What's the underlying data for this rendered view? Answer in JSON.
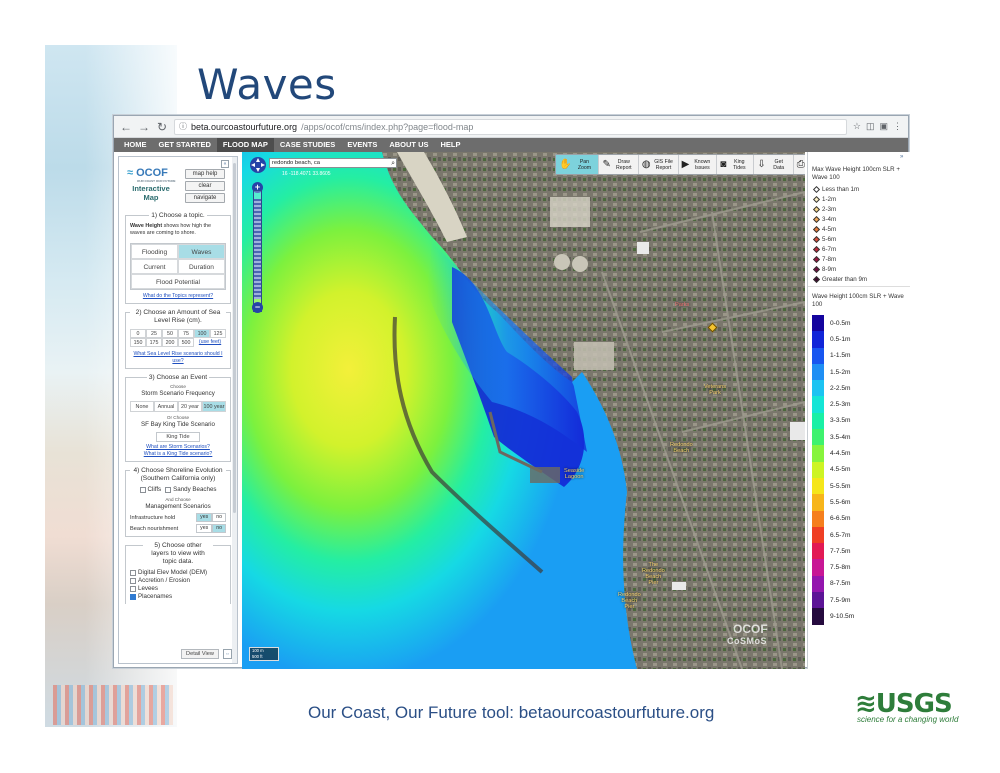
{
  "slide": {
    "title": "Waves",
    "footer": "Our Coast, Our Future tool: betaourcoastourfuture.org",
    "logo_text": "USGS",
    "logo_tagline": "science for a changing world"
  },
  "browser": {
    "url_host": "beta.ourcoastourfuture.org",
    "url_path": "/apps/ocof/cms/index.php?page=flood-map"
  },
  "site_nav": [
    {
      "label": "HOME",
      "active": false
    },
    {
      "label": "GET STARTED",
      "active": false
    },
    {
      "label": "FLOOD MAP",
      "active": true
    },
    {
      "label": "CASE STUDIES",
      "active": false
    },
    {
      "label": "EVENTS",
      "active": false
    },
    {
      "label": "ABOUT US",
      "active": false
    },
    {
      "label": "HELP",
      "active": false
    }
  ],
  "sidebar": {
    "logo": "OCOF",
    "logo_sub": "OUR COAST OUR FUTURE",
    "title": "Interactive Map",
    "buttons": {
      "map_help": "map help",
      "clear": "clear",
      "navigate": "navigate"
    },
    "s1": {
      "title": "1) Choose a topic.",
      "desc_bold": "Wave Height",
      "desc": " shows how high the waves are coming to shore.",
      "topics": [
        "Flooding",
        "Waves",
        "Current",
        "Duration"
      ],
      "topic_wide": "Flood Potential",
      "active_topic": "Waves",
      "link": "What do the Topics represent?"
    },
    "s2": {
      "title": "2) Choose an Amount of Sea Level Rise (cm).",
      "values": [
        "0",
        "25",
        "50",
        "75",
        "100",
        "125",
        "150",
        "175",
        "200",
        "500"
      ],
      "active": "100",
      "feet_link": "(use feet)",
      "link": "What Sea Level Rise scenario should I use?"
    },
    "s3": {
      "title": "3) Choose an Event",
      "choose": "Choose",
      "freq_label": "Storm Scenario Frequency",
      "events": [
        "None",
        "Annual",
        "20 year",
        "100 year"
      ],
      "active": "100 year",
      "or_choose": "Or Choose",
      "king_label": "SF Bay King Tide Scenario",
      "king_btn": "King Tide",
      "link1": "What are Storm Scenarios?",
      "link2": "What is a King Tide scenario?"
    },
    "s4": {
      "title": "4) Choose Shoreline Evolution (Southern California only)",
      "cliffs": "Cliffs",
      "sandy": "Sandy Beaches",
      "and_choose": "And Choose",
      "mgmt": "Management Scenarios",
      "infra": "Infrastructure hold",
      "beach": "Beach nourishment",
      "yes": "yes",
      "no": "no"
    },
    "s5": {
      "title": "5) Choose other layers to view with topic data.",
      "layers": [
        {
          "label": "Digital Elev Model (DEM)",
          "checked": false
        },
        {
          "label": "Accretion / Erosion",
          "checked": false
        },
        {
          "label": "Levees",
          "checked": false
        },
        {
          "label": "Placenames",
          "checked": true
        }
      ]
    },
    "detail_view": "Detail View"
  },
  "map": {
    "search_value": "redondo beach, ca",
    "coords": "16 -118.4071 33.8605",
    "scale_m": "100 m",
    "scale_ft": "500 ft",
    "watermark": "OCOF",
    "watermark2": "CoSMoS",
    "toolbar": [
      {
        "icon": "hand-icon",
        "glyph": "✋",
        "label": "Pan\nZoom",
        "active": true
      },
      {
        "icon": "pencil-icon",
        "glyph": "✎",
        "label": "Draw\nReport",
        "active": false
      },
      {
        "icon": "globe-icon",
        "glyph": "◍",
        "label": "GIS File\nReport",
        "active": false
      },
      {
        "icon": "play-icon",
        "glyph": "▶",
        "label": "Known\nIssues",
        "active": false
      },
      {
        "icon": "camera-icon",
        "glyph": "◙",
        "label": "King\nTides",
        "active": false
      },
      {
        "icon": "download-icon",
        "glyph": "⇩",
        "label": "Get\nData",
        "active": false
      },
      {
        "icon": "printer-icon",
        "glyph": "⎙",
        "label": "Print\nMap",
        "active": false
      }
    ],
    "places": [
      {
        "label": "Redondo\nBeach",
        "style": "big"
      },
      {
        "label": "Seaside\nLagoon",
        "style": "normal"
      },
      {
        "label": "Redondo\nBeach\nPier",
        "style": "normal"
      },
      {
        "label": "The\nRedondo\nBeach\nPier",
        "style": "normal"
      },
      {
        "label": "Veterans\nPark",
        "style": "normal"
      },
      {
        "label": "Parks",
        "style": "red"
      }
    ]
  },
  "legend": {
    "points_title": "Max Wave Height 100cm SLR + Wave 100",
    "points": [
      {
        "label": "Less than 1m",
        "color": "#ffffff"
      },
      {
        "label": "1-2m",
        "color": "#fdf1c4"
      },
      {
        "label": "2-3m",
        "color": "#f9d98a"
      },
      {
        "label": "3-4m",
        "color": "#f3a857"
      },
      {
        "label": "4-5m",
        "color": "#ea7d3b"
      },
      {
        "label": "5-6m",
        "color": "#d94f3b"
      },
      {
        "label": "6-7m",
        "color": "#c02a3b"
      },
      {
        "label": "7-8m",
        "color": "#99163f"
      },
      {
        "label": "8-9m",
        "color": "#6e0e3e"
      },
      {
        "label": "Greater than 9m",
        "color": "#3d0a2c"
      }
    ],
    "ramp_title": "Wave Height 100cm SLR + Wave 100",
    "ramp": [
      {
        "label": "0-0.5m",
        "color": "#14049e"
      },
      {
        "label": "0.5-1m",
        "color": "#1125d8"
      },
      {
        "label": "1-1.5m",
        "color": "#1856f0"
      },
      {
        "label": "1.5-2m",
        "color": "#1f8ff4"
      },
      {
        "label": "2-2.5m",
        "color": "#1cc3f2"
      },
      {
        "label": "2.5-3m",
        "color": "#14e5d6"
      },
      {
        "label": "3-3.5m",
        "color": "#19f0a5"
      },
      {
        "label": "3.5-4m",
        "color": "#3ef26e"
      },
      {
        "label": "4-4.5m",
        "color": "#87f43d"
      },
      {
        "label": "4.5-5m",
        "color": "#cdf424"
      },
      {
        "label": "5-5.5m",
        "color": "#f5e61a"
      },
      {
        "label": "5.5-6m",
        "color": "#f7b51a"
      },
      {
        "label": "6-6.5m",
        "color": "#f57f1d"
      },
      {
        "label": "6.5-7m",
        "color": "#ef3f24"
      },
      {
        "label": "7-7.5m",
        "color": "#e21a54"
      },
      {
        "label": "7.5-8m",
        "color": "#c81795"
      },
      {
        "label": "8-7.5m",
        "color": "#9416ae"
      },
      {
        "label": "7.5-9m",
        "color": "#5c1496"
      },
      {
        "label": "9-10.5m",
        "color": "#250a3e"
      }
    ]
  }
}
